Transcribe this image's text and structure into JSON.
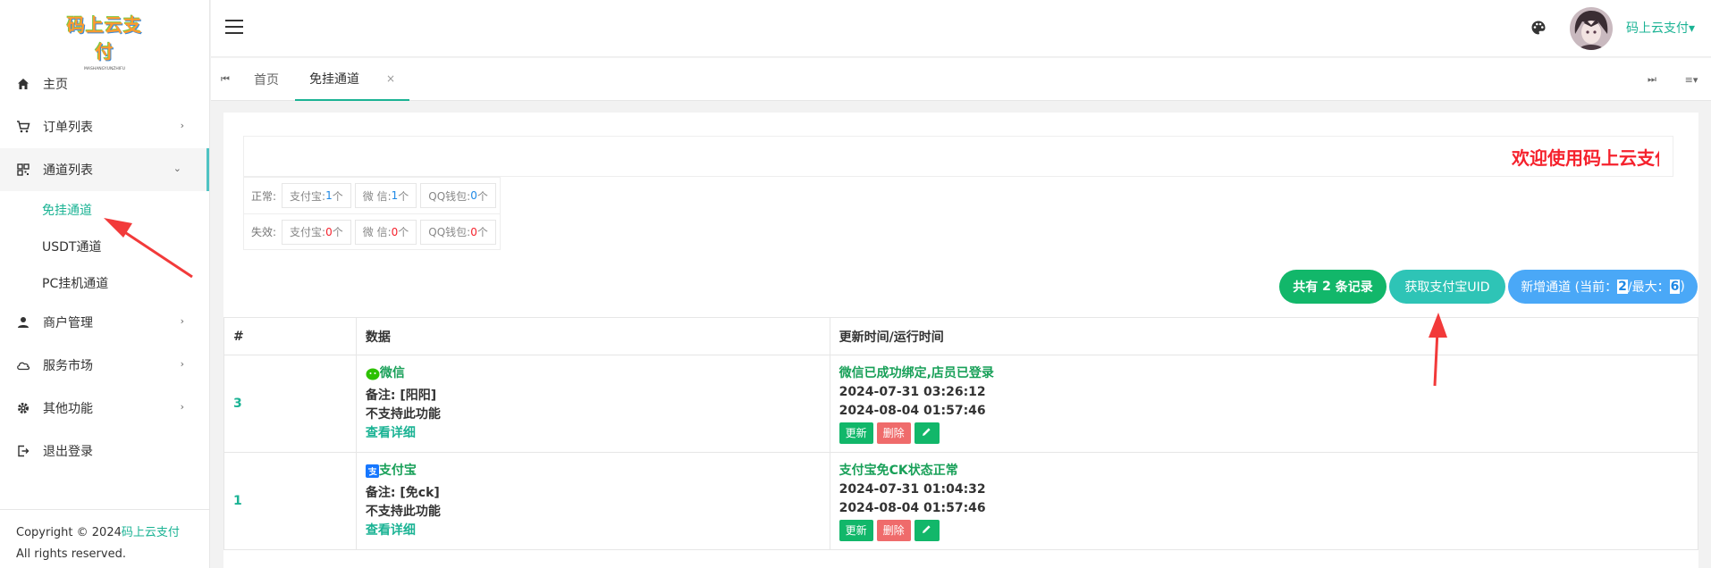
{
  "brand": {
    "logo_text": "码上云支付",
    "logo_sub": "MASHANGYUNZHIFU"
  },
  "sidebar": {
    "items": [
      {
        "label": "主页",
        "icon": "home-icon"
      },
      {
        "label": "订单列表",
        "icon": "cart-icon",
        "arrow": "›"
      },
      {
        "label": "通道列表",
        "icon": "qrcode-icon",
        "arrow": "⌄"
      },
      {
        "label": "商户管理",
        "icon": "user-icon",
        "arrow": "›"
      },
      {
        "label": "服务市场",
        "icon": "cloud-icon",
        "arrow": "›"
      },
      {
        "label": "其他功能",
        "icon": "gear-icon",
        "arrow": "›"
      },
      {
        "label": "退出登录",
        "icon": "logout-icon"
      }
    ],
    "subitems": [
      "免挂通道",
      "USDT通道",
      "PC挂机通道"
    ],
    "footer": {
      "prefix": "Copyright © 2024",
      "brand": "码上云支付",
      "suffix": " All rights reserved."
    }
  },
  "header": {
    "user_name": "码上云支付",
    "caret": "▾"
  },
  "tabs": {
    "items": [
      "首页",
      "免挂通道"
    ],
    "close": "×",
    "prev": "⏮",
    "next": "⏭",
    "menu": "≡▾"
  },
  "welcome": "欢迎使用码上云支付",
  "stats": {
    "normal_label": "正常:",
    "failed_label": "失效:",
    "normal": [
      {
        "name": "支付宝:",
        "count": "1",
        "unit": "个"
      },
      {
        "name": "微 信:",
        "count": "1",
        "unit": "个"
      },
      {
        "name": "QQ钱包:",
        "count": "0",
        "unit": "个"
      }
    ],
    "failed": [
      {
        "name": "支付宝:",
        "count": "0",
        "unit": "个"
      },
      {
        "name": "微 信:",
        "count": "0",
        "unit": "个"
      },
      {
        "name": "QQ钱包:",
        "count": "0",
        "unit": "个"
      }
    ]
  },
  "actions": {
    "records": {
      "prefix": "共有 ",
      "count": "2",
      "suffix": " 条记录"
    },
    "get_uid": "获取支付宝UID",
    "add": {
      "prefix": "新增通道 (当前：",
      "current": "2",
      "middle": "/最大：",
      "max": "6",
      "suffix": ")"
    }
  },
  "table": {
    "headers": [
      "#",
      "数据",
      "更新时间/运行时间"
    ],
    "rows": [
      {
        "id": "3",
        "channel": "微信",
        "channel_icon": "wechat-icon",
        "remark": "备注: [阳阳]",
        "support": "不支持此功能",
        "detail": "查看详细",
        "status": "微信已成功绑定,店员已登录",
        "updated": "2024-07-31 03:26:12",
        "running": "2024-08-04 01:57:46"
      },
      {
        "id": "1",
        "channel": "支付宝",
        "channel_icon": "alipay-icon",
        "remark": "备注: [免ck]",
        "support": "不支持此功能",
        "detail": "查看详细",
        "status": "支付宝免CK状态正常",
        "updated": "2024-07-31 01:04:32",
        "running": "2024-08-04 01:57:46"
      }
    ],
    "btn_update": "更新",
    "btn_delete": "删除"
  },
  "colors": {
    "accent": "#1bb394",
    "danger": "#f5222d",
    "pill_green": "#12b76a",
    "pill_teal": "#2ec4b6",
    "pill_blue": "#4aa8f7"
  }
}
